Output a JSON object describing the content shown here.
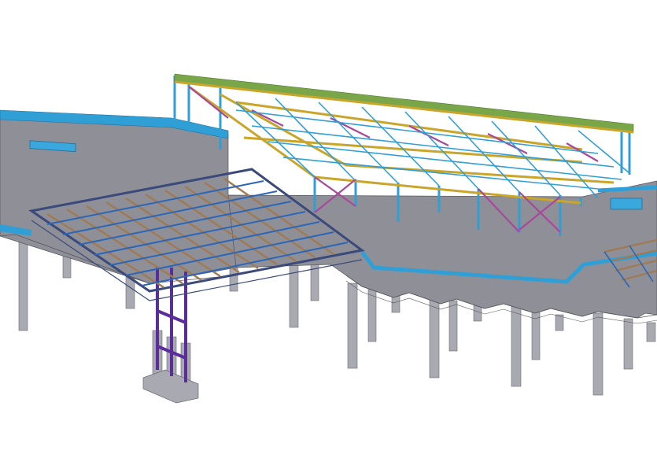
{
  "colors": {
    "background": "#ffffff",
    "slab_top": "#8f8f97",
    "slab_side": "#9c9ca4",
    "column": "#a9a9b1",
    "column_shade": "#8b8b93",
    "edge_beam": "#2f9fd6",
    "canopy_beam": "#2b66b8",
    "canopy_edge": "#3a4a7a",
    "canopy_joist": "#a07a52",
    "canopy_post": "#5a2d9a",
    "roof_chord": "#c9a52a",
    "roof_brace": "#a8489c",
    "roof_top_beam": "#7aa64a",
    "roof_post": "#2f9fd6",
    "line": "#5a5a62"
  }
}
